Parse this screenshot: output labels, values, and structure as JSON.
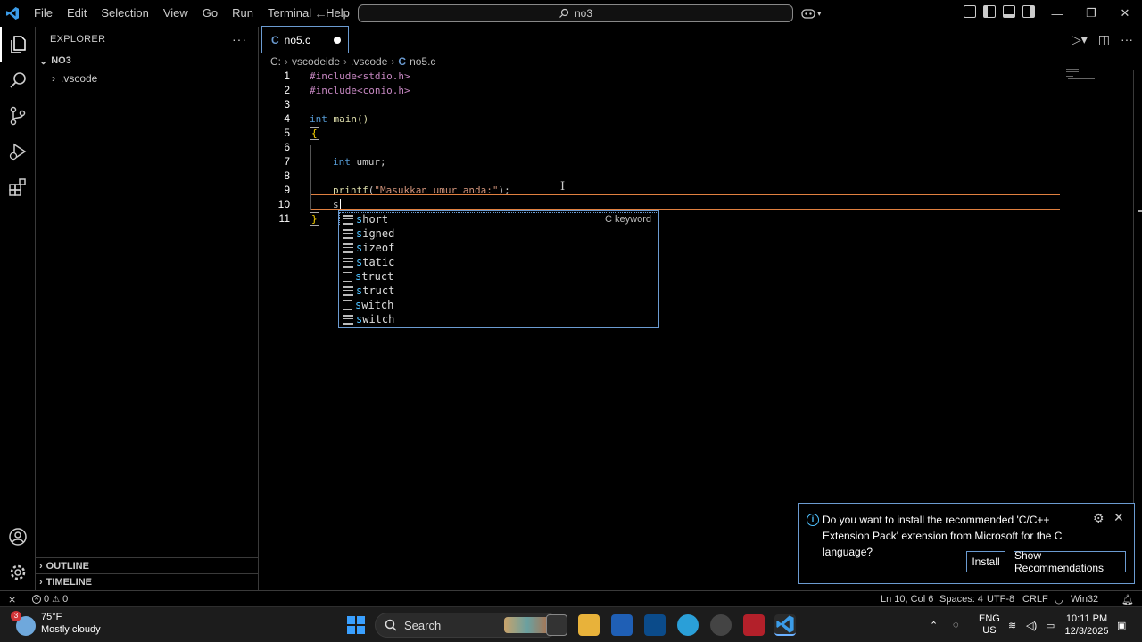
{
  "titlebar": {
    "menu": [
      "File",
      "Edit",
      "Selection",
      "View",
      "Go",
      "Run",
      "Terminal",
      "Help"
    ],
    "search_text": "no3"
  },
  "sidebar": {
    "title": "EXPLORER",
    "folder": "NO3",
    "items": [
      ".vscode"
    ],
    "outline": "OUTLINE",
    "timeline": "TIMELINE"
  },
  "tab": {
    "label": "no5.c",
    "lang_icon": "C"
  },
  "breadcrumb": [
    "C:",
    "vscodeide",
    ".vscode",
    "no5.c"
  ],
  "code": {
    "line_numbers": [
      "1",
      "2",
      "3",
      "4",
      "5",
      "6",
      "7",
      "8",
      "9",
      "10",
      "11"
    ],
    "l1": "#include<stdio.h>",
    "l2": "#include<conio.h>",
    "l4_kw": "int",
    "l4_rest": " main()",
    "l5": "{",
    "l7_kw": "int",
    "l7_rest": " umur;",
    "l9_fn": "printf",
    "l9_a": "(",
    "l9_str": "\"Masukkan umur anda:\"",
    "l9_b": ");",
    "l10": "s",
    "l11": "}"
  },
  "suggest": {
    "items": [
      {
        "first": "s",
        "rest": "hort",
        "icon": "keyword-icon",
        "detail": "C keyword"
      },
      {
        "first": "s",
        "rest": "igned",
        "icon": "keyword-icon"
      },
      {
        "first": "s",
        "rest": "izeof",
        "icon": "keyword-icon"
      },
      {
        "first": "s",
        "rest": "tatic",
        "icon": "keyword-icon"
      },
      {
        "first": "s",
        "rest": "truct",
        "icon": "snippet-icon"
      },
      {
        "first": "s",
        "rest": "truct",
        "icon": "keyword-icon"
      },
      {
        "first": "s",
        "rest": "witch",
        "icon": "snippet-icon"
      },
      {
        "first": "s",
        "rest": "witch",
        "icon": "keyword-icon"
      }
    ]
  },
  "notification": {
    "message": "Do you want to install the recommended 'C/C++ Extension Pack' extension from Microsoft for the C language?",
    "install": "Install",
    "show": "Show Recommendations"
  },
  "status": {
    "errors": "0",
    "warnings": "0",
    "position": "Ln 10, Col 6",
    "spaces": "Spaces: 4",
    "encoding": "UTF-8",
    "eol": "CRLF",
    "platform": "Win32"
  },
  "taskbar": {
    "weather_badge": "3",
    "temp": "75°F",
    "condition": "Mostly cloudy",
    "search": "Search",
    "lang1": "ENG",
    "lang2": "US",
    "time": "10:11 PM",
    "date": "12/3/2025"
  },
  "colors": {
    "accent": "#6b9bd1",
    "current_line": "#e08040",
    "keyword": "#569cd6",
    "string": "#ce9178"
  }
}
